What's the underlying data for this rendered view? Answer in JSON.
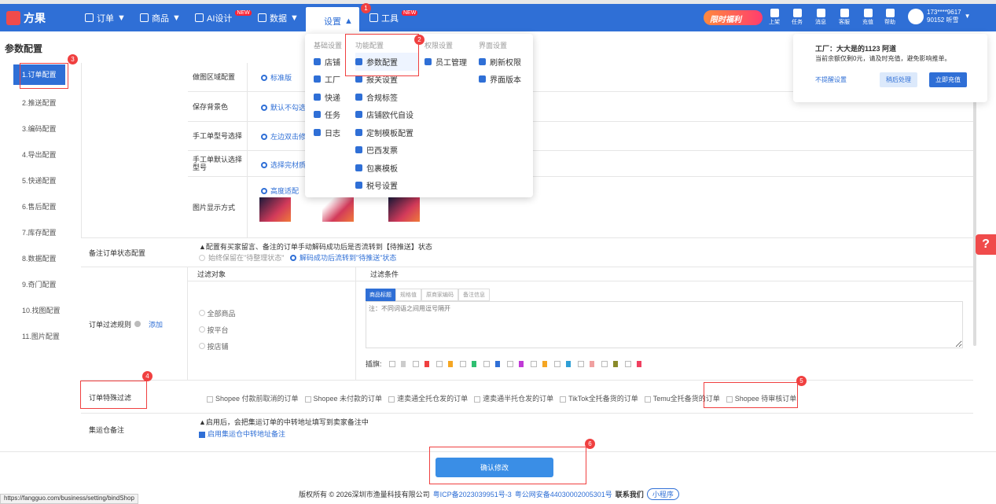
{
  "nav": {
    "brand": "方果",
    "menus": [
      {
        "label": "订单",
        "arrow": "▼"
      },
      {
        "label": "商品",
        "arrow": "▼"
      },
      {
        "label": "AI设计",
        "badge": "NEW"
      },
      {
        "label": "数据",
        "arrow": "▼"
      },
      {
        "label": "设置",
        "arrow": "▲"
      },
      {
        "label": "工具",
        "badge": "NEW"
      }
    ],
    "promo": "限时福利",
    "tools": [
      "上架",
      "任务",
      "消息",
      "客服",
      "充值",
      "帮助"
    ],
    "user_line1": "173****9617",
    "user_line2": "90152 听雪"
  },
  "page_title": "参数配置",
  "sidebar": [
    "1.订单配置",
    "2.推送配置",
    "3.编码配置",
    "4.导出配置",
    "5.快递配置",
    "6.售后配置",
    "7.库存配置",
    "8.数据配置",
    "9.奇门配置",
    "10.找图配置",
    "11.图片配置"
  ],
  "settings_dropdown": {
    "headers": [
      "基础设置",
      "功能配置",
      "权限设置",
      "界面设置"
    ],
    "col1": [
      "店铺",
      "工厂",
      "快递",
      "任务",
      "日志"
    ],
    "col2": [
      "参数配置",
      "报关设置",
      "合规标签",
      "店铺欧代自设",
      "定制模板配置",
      "巴西发票",
      "包裹模板",
      "税号设置"
    ],
    "col3": [
      "员工管理"
    ],
    "col4": [
      "刷新权限",
      "界面版本"
    ]
  },
  "notice": {
    "title": "工厂：大大是的1123 阿道",
    "text": "当前余额仅剩0元，请及时充值，避免影响推单。",
    "no_remind": "不提醒设置",
    "later": "稍后处理",
    "recharge": "立即充值"
  },
  "image_rows": [
    {
      "label": "做图区域配置",
      "option": "标准版"
    },
    {
      "label": "保存背景色",
      "option": "默认不勾选"
    },
    {
      "label": "手工单型号选择",
      "option": "左边双击修改"
    },
    {
      "label": "手工单默认选择型号",
      "option": "选择完材质后"
    },
    {
      "label": "图片显示方式",
      "option": "高度适配"
    }
  ],
  "remark_status": {
    "label": "备注订单状态配置",
    "note": "▲配置有买家留言、备注的订单手动解码成功后是否流转到【待推送】状态",
    "opt1": "始终保留在\"待整理状态\"",
    "opt2": "解码成功后流转到\"待推送\"状态"
  },
  "filter_rules": {
    "label": "订单过滤规则",
    "add": "添加",
    "col_object": "过滤对象",
    "col_cond": "过滤条件",
    "objects": [
      "全部商品",
      "按平台",
      "按店铺"
    ],
    "tabs": [
      "商品标题",
      "规格值",
      "原商家编码",
      "备注信息"
    ],
    "placeholder": "注：不同词语之间用逗号隔开",
    "flag_label": "插旗:",
    "flag_colors": [
      "#cccccc",
      "#f04040",
      "#f5a623",
      "#2fbf71",
      "#2f6fd6",
      "#c03ad6",
      "#f5a623",
      "#2f9fd6",
      "#f0a0a0",
      "#8a8a2a",
      "#f04060"
    ]
  },
  "special_filter": {
    "label": "订单特殊过滤",
    "options": [
      "Shopee 付款前取消的订单",
      "Shopee 未付款的订单",
      "速卖通全托仓发的订单",
      "速卖通半托仓发的订单",
      "TikTok全托备货的订单",
      "Temu全托备货的订单",
      "Shopee 待审核订单"
    ]
  },
  "consolidation": {
    "label": "集运仓备注",
    "note": "▲启用后，会把集运订单的中转地址填写到卖家备注中",
    "option": "启用集运仓中转地址备注"
  },
  "confirm": "确认修改",
  "footer": {
    "copyright": "版权所有 © 2026深圳市渔量科技有限公司",
    "icp": "粤ICP备2023039951号-3",
    "police": "粤公网安备44030002005301号",
    "contact": "联系我们",
    "miniapp": "小程序"
  },
  "status_url": "https://fangguo.com/business/setting/bindShop",
  "markers": [
    "1",
    "2",
    "3",
    "4",
    "5",
    "6"
  ],
  "help_float": "?"
}
